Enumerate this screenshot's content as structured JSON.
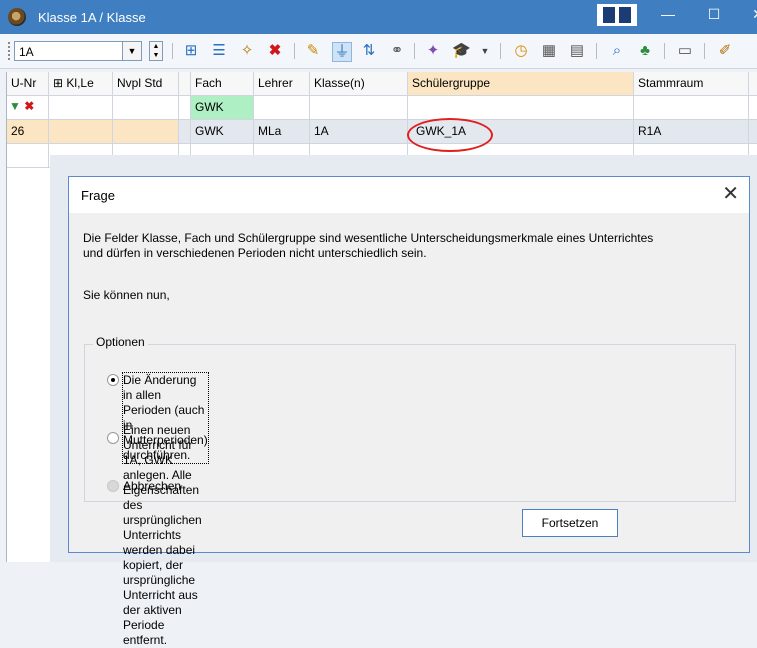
{
  "window": {
    "title": "Klasse 1A / Klasse"
  },
  "toolbar": {
    "class_combo_value": "1A"
  },
  "grid": {
    "headers": [
      "U-Nr",
      "Kl,Le",
      "Nvpl Std",
      "Fach",
      "Lehrer",
      "Klasse(n)",
      "Schülergruppe",
      "Stammraum"
    ],
    "header_expand": "⊞",
    "filter_row": {
      "fach": "GWK"
    },
    "data_row": {
      "unr": "26",
      "kl_le": "",
      "nvpl_std": "",
      "fach": "GWK",
      "lehrer": "MLa",
      "klassen": "1A",
      "schuelergruppe": "GWK_1A",
      "stammraum": "R1A"
    }
  },
  "dialog": {
    "title": "Frage",
    "message_line1": "Die Felder Klasse, Fach und Schülergruppe sind wesentliche Unterscheidungsmerkmale eines Unterrichtes",
    "message_line2": "und dürfen in verschiedenen Perioden nicht unterschiedlich sein.",
    "message_prompt": "Sie können nun,",
    "group_label": "Optionen",
    "option1": "Die Änderung in allen Perioden (auch in Mutterperioden) durchführen.",
    "option2_line1": "Einen neuen Unterricht für 1A, GWK anlegen. Alle Eigenschaften des ursprünglichen Unterrichts",
    "option2_line2": "werden dabei kopiert, der ursprüngliche Unterricht aus der aktiven Periode entfernt.",
    "option3": "Abbrechen",
    "continue_button": "Fortsetzen",
    "close_glyph": "✕"
  },
  "colors": {
    "titlebar": "#3f7fc1",
    "accent_orange": "#fbe5c2",
    "filter_green": "#aef0c4",
    "highlight_circle": "#e02020"
  }
}
